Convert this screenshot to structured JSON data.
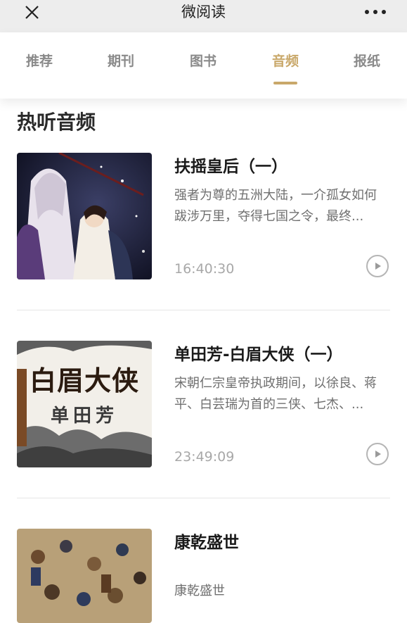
{
  "window": {
    "title": "微阅读"
  },
  "icons": {
    "close": "close-icon",
    "more": "more-icon",
    "play": "play-icon"
  },
  "colors": {
    "accent": "#c9a86a",
    "inactive_tab": "#8a8a8a",
    "time": "#a8a8a8"
  },
  "tabs": [
    {
      "label": "推荐",
      "active": false
    },
    {
      "label": "期刊",
      "active": false
    },
    {
      "label": "图书",
      "active": false
    },
    {
      "label": "音频",
      "active": true
    },
    {
      "label": "报纸",
      "active": false
    }
  ],
  "section": {
    "title": "热听音频"
  },
  "items": [
    {
      "title": "扶摇皇后（一）",
      "description": "强者为尊的五洲大陆，一介孤女如何跋涉万里，夺得七国之令，最终...",
      "duration": "16:40:30"
    },
    {
      "title": "单田芳-白眉大侠（一）",
      "description": "宋朝仁宗皇帝执政期间，以徐良、蒋平、白芸瑞为首的三侠、七杰、...",
      "duration": "23:49:09",
      "cover_text": "白眉大侠",
      "cover_subtext": "单田芳"
    },
    {
      "title": "康乾盛世",
      "description": "康乾盛世"
    }
  ]
}
